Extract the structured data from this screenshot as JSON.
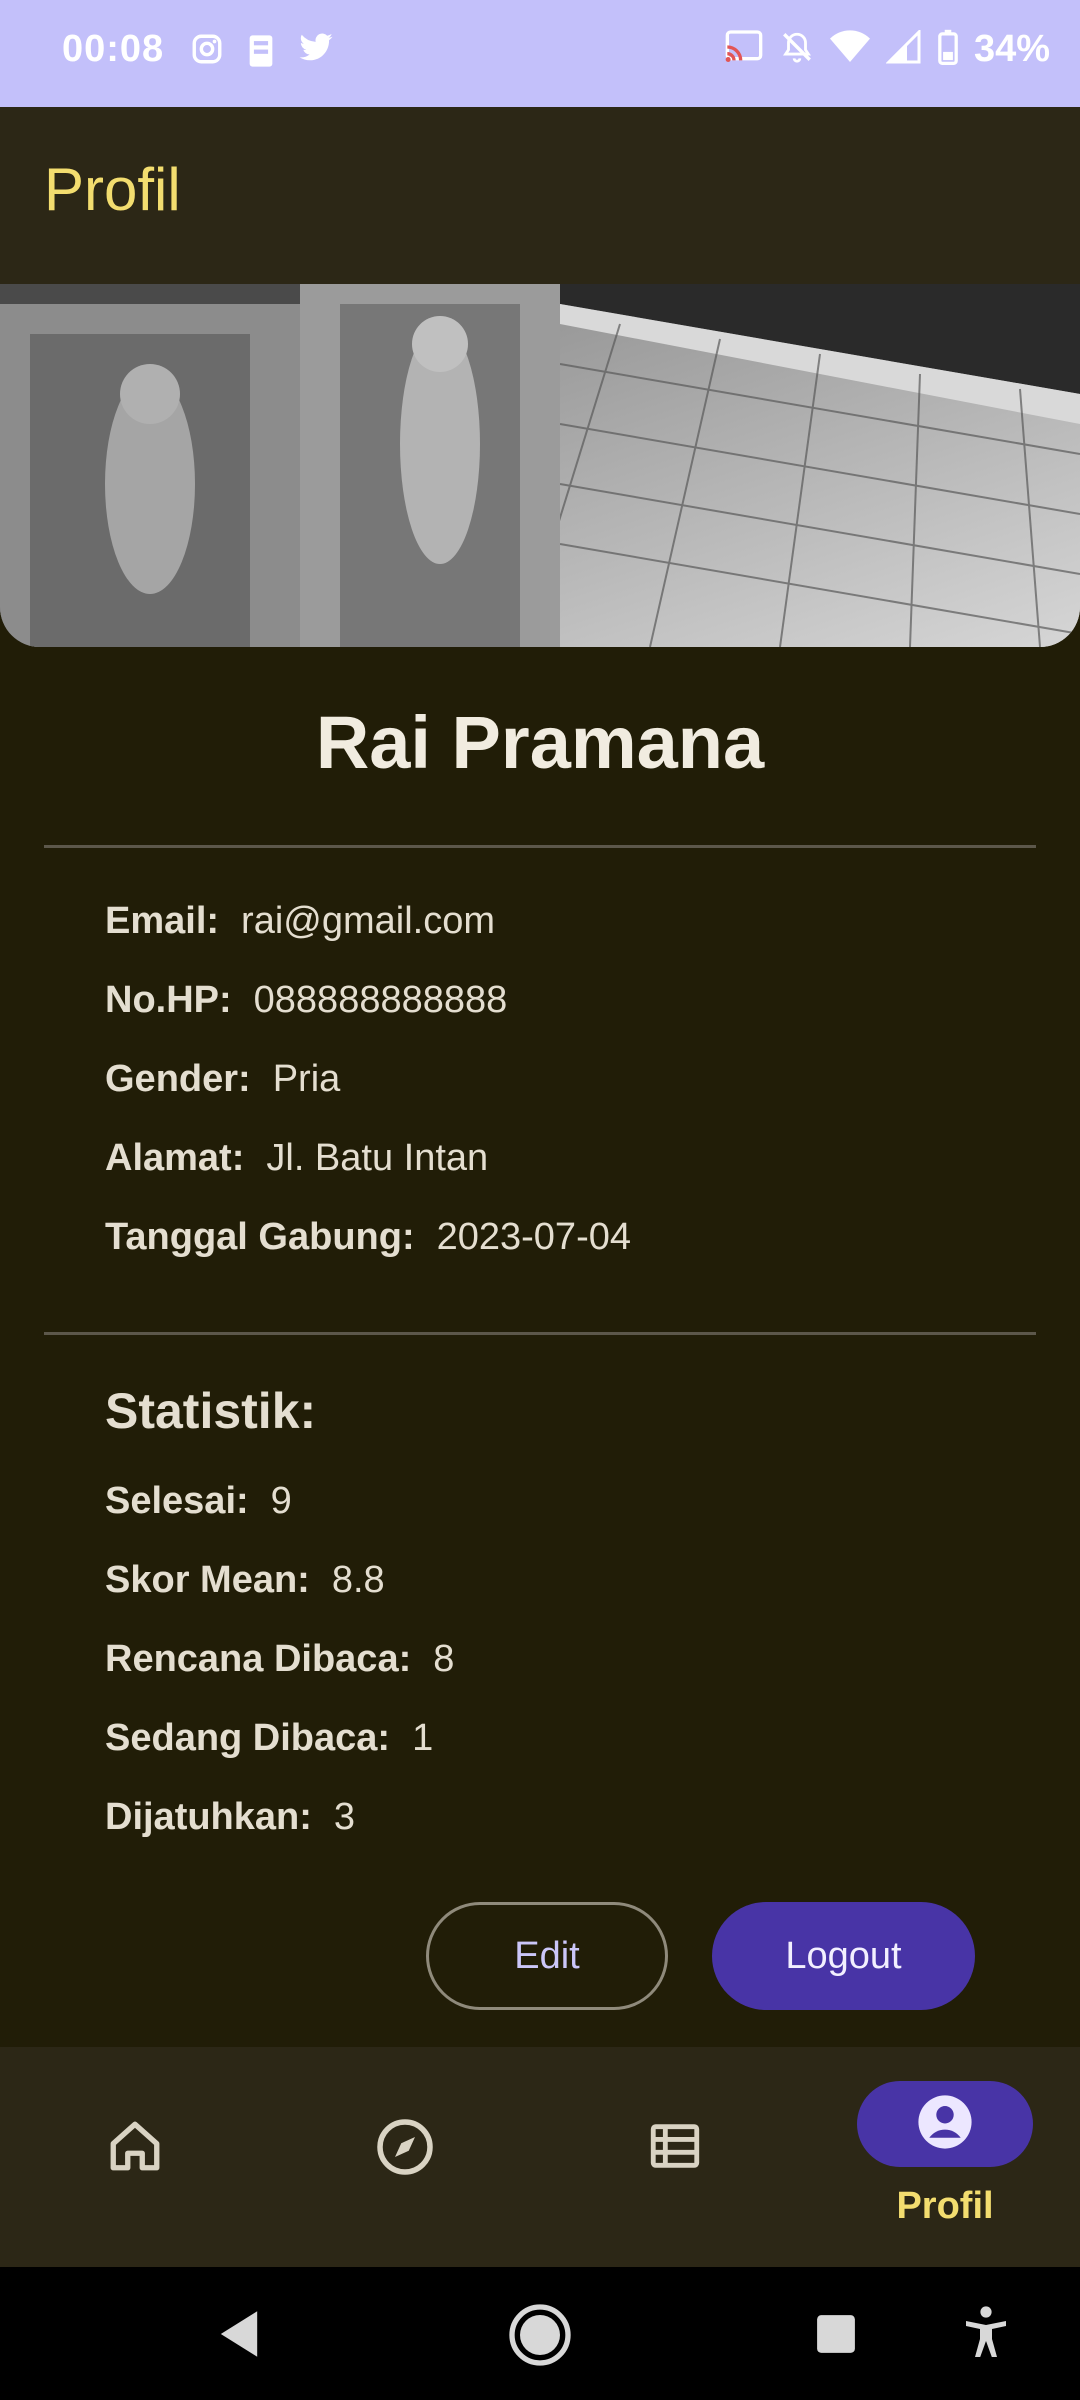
{
  "status_bar": {
    "time": "00:08",
    "left_icons": [
      "instagram-icon",
      "tasks-icon",
      "twitter-icon"
    ],
    "right_icons": [
      "cast-icon",
      "bell-off-icon",
      "wifi-icon",
      "signal-icon",
      "battery-icon"
    ],
    "battery": "34%"
  },
  "app_bar": {
    "title": "Profil"
  },
  "profile": {
    "name": "Rai Pramana",
    "info": [
      {
        "label": "Email:",
        "value": "rai@gmail.com"
      },
      {
        "label": "No.HP:",
        "value": "088888888888"
      },
      {
        "label": "Gender:",
        "value": "Pria"
      },
      {
        "label": "Alamat:",
        "value": "Jl. Batu Intan"
      },
      {
        "label": "Tanggal Gabung:",
        "value": "2023-07-04"
      }
    ]
  },
  "stats": {
    "title": "Statistik:",
    "items": [
      {
        "label": "Selesai:",
        "value": "9"
      },
      {
        "label": "Skor Mean:",
        "value": "8.8"
      },
      {
        "label": "Rencana Dibaca:",
        "value": "8"
      },
      {
        "label": "Sedang Dibaca:",
        "value": "1"
      },
      {
        "label": "Dijatuhkan:",
        "value": "3"
      }
    ]
  },
  "buttons": {
    "edit": "Edit",
    "logout": "Logout"
  },
  "bottom_nav": {
    "items": [
      {
        "icon": "home-icon"
      },
      {
        "icon": "compass-icon"
      },
      {
        "icon": "list-icon"
      },
      {
        "icon": "account-icon",
        "label": "Profil",
        "active": true
      }
    ]
  },
  "colors": {
    "accent": "#f3dd6f",
    "primary": "#4834a6",
    "background": "#211d07",
    "surface": "#2c2716",
    "status_bar": "#c3c0fa"
  }
}
